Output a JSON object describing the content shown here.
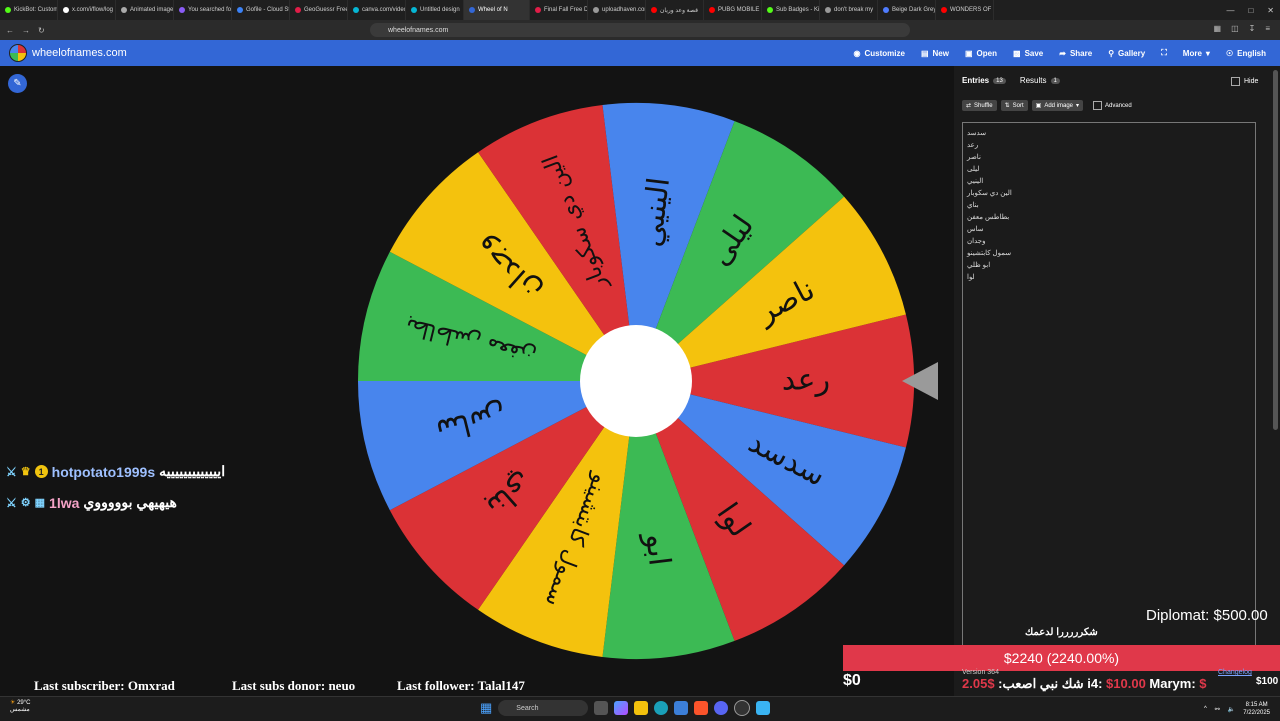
{
  "browser": {
    "tabs": [
      {
        "title": "KickBot: Custom",
        "color": "#53fc18"
      },
      {
        "title": "x.com/i/flow/log",
        "color": "#ffffff"
      },
      {
        "title": "Animated image",
        "color": "#aaaaaa"
      },
      {
        "title": "You searched fo",
        "color": "#8b5cf6"
      },
      {
        "title": "Gofile - Cloud St",
        "color": "#3b82f6"
      },
      {
        "title": "GeoGuessr Free",
        "color": "#e11d48"
      },
      {
        "title": "canva.com/video",
        "color": "#06b6d4"
      },
      {
        "title": "Untitled design",
        "color": "#06b6d4"
      },
      {
        "title": "Wheel of N",
        "color": "#3367d6",
        "active": true
      },
      {
        "title": "Final Fall Free Dr",
        "color": "#e11d48"
      },
      {
        "title": "uploadhaven.com",
        "color": "#999999"
      },
      {
        "title": "قصة وعد وريان",
        "color": "#ff0000"
      },
      {
        "title": "PUBG MOBILE",
        "color": "#ff0000"
      },
      {
        "title": "Sub Badges - Ki",
        "color": "#53fc18"
      },
      {
        "title": "don't break my",
        "color": "#999999"
      },
      {
        "title": "Beige Dark Grey",
        "color": "#4f7cff"
      },
      {
        "title": "WONDERS OF C",
        "color": "#ff0000"
      }
    ],
    "url": "wheelofnames.com"
  },
  "app": {
    "brand": "wheelofnames.com",
    "menu": [
      "Customize",
      "New",
      "Open",
      "Save",
      "Share",
      "Gallery",
      "Fullscreen",
      "More",
      "English"
    ],
    "menu_visible": [
      "Customize",
      "New",
      "Open",
      "Save",
      "Share",
      "Gallery",
      "",
      "More",
      "English"
    ]
  },
  "panel": {
    "tab_entries": "Entries",
    "entries_count": "13",
    "tab_results": "Results",
    "results_count": "1",
    "hide": "Hide",
    "shuffle": "Shuffle",
    "sort": "Sort",
    "add_image": "Add image",
    "advanced": "Advanced",
    "entries": [
      "سدسد",
      "رعد",
      "ناصر",
      "ليلى",
      "الينيي",
      "الين دي سكوبار",
      "بناي",
      "بطاطس معفن",
      "ساس",
      "وجدان",
      "سمول كابتشينو",
      "ابو ظلي",
      "لوا"
    ],
    "version": "Version 364",
    "changelog": "Changelog"
  },
  "wheel": {
    "colors": [
      "#db3236",
      "#f4c20d",
      "#3cba54",
      "#4885ed"
    ],
    "segments": [
      {
        "label": "رعد",
        "color": "#db3236"
      },
      {
        "label": "سدسد",
        "color": "#4885ed"
      },
      {
        "label": "لوا",
        "color": "#db3236"
      },
      {
        "label": "ابو",
        "color": "#3cba54"
      },
      {
        "label": "سمول كابتشينو",
        "color": "#f4c20d"
      },
      {
        "label": "بناي",
        "color": "#db3236"
      },
      {
        "label": "ساس",
        "color": "#4885ed"
      },
      {
        "label": "بطاطس معفن",
        "color": "#3cba54"
      },
      {
        "label": "وجدان",
        "color": "#f4c20d"
      },
      {
        "label": "الين دي سكوبار",
        "color": "#db3236"
      },
      {
        "label": "الينيي",
        "color": "#4885ed"
      },
      {
        "label": "ليلى",
        "color": "#3cba54"
      },
      {
        "label": "ناصر",
        "color": "#f4c20d"
      }
    ]
  },
  "overlay": {
    "chat": [
      {
        "user": "hotpotato1999s",
        "badge": "1",
        "message": "ايييييييييييييه"
      },
      {
        "user": "1lwa",
        "badge": "",
        "message": "هيهيهي بوووووي"
      }
    ],
    "last_subscriber": "Last subscriber: Omxrad",
    "last_subs_donor": "Last subs donor: neuo",
    "last_follower": "Last follower: Talal147",
    "money_left": "$0",
    "goal": "$2240 (2240.00%)",
    "diplomat": "Diplomat: $500.00",
    "thanks": "شكرررررا لدعمك",
    "ticker": [
      {
        "text": "شك ",
        "red": false
      },
      {
        "text": "نبي اصعب: ",
        "red": false
      },
      {
        "text": "$2.05",
        "red": true
      },
      {
        "text": "   i4: ",
        "red": false
      },
      {
        "text": "$10.00",
        "red": true
      },
      {
        "text": "   Marym: ",
        "red": false
      },
      {
        "text": "$",
        "red": true
      }
    ],
    "ticker_right": "$100"
  },
  "taskbar": {
    "weather_temp": "29°C",
    "weather_text": "مشمس",
    "search": "Search",
    "time": "8:15 AM",
    "date": "7/22/2025"
  }
}
